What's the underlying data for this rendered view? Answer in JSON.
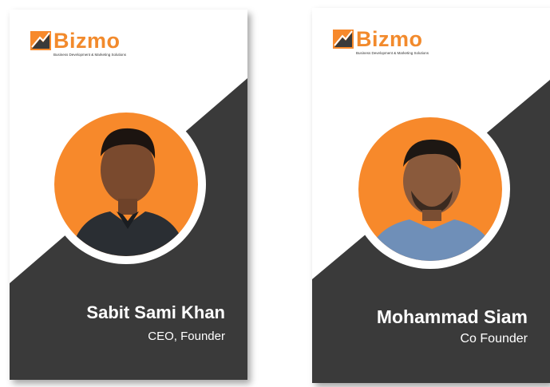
{
  "brand": {
    "name": "Bizmo",
    "tagline": "Business Development & Marketing Solutions",
    "logo_icon": "growth-chart-icon",
    "accent_color": "#f7892b",
    "dark_color": "#3a3a3a"
  },
  "cards": [
    {
      "name": "Sabit Sami Khan",
      "role": "CEO, Founder",
      "photo_icon": "person-portrait-icon"
    },
    {
      "name": "Mohammad Siam",
      "role": "Co Founder",
      "photo_icon": "person-portrait-icon"
    }
  ]
}
